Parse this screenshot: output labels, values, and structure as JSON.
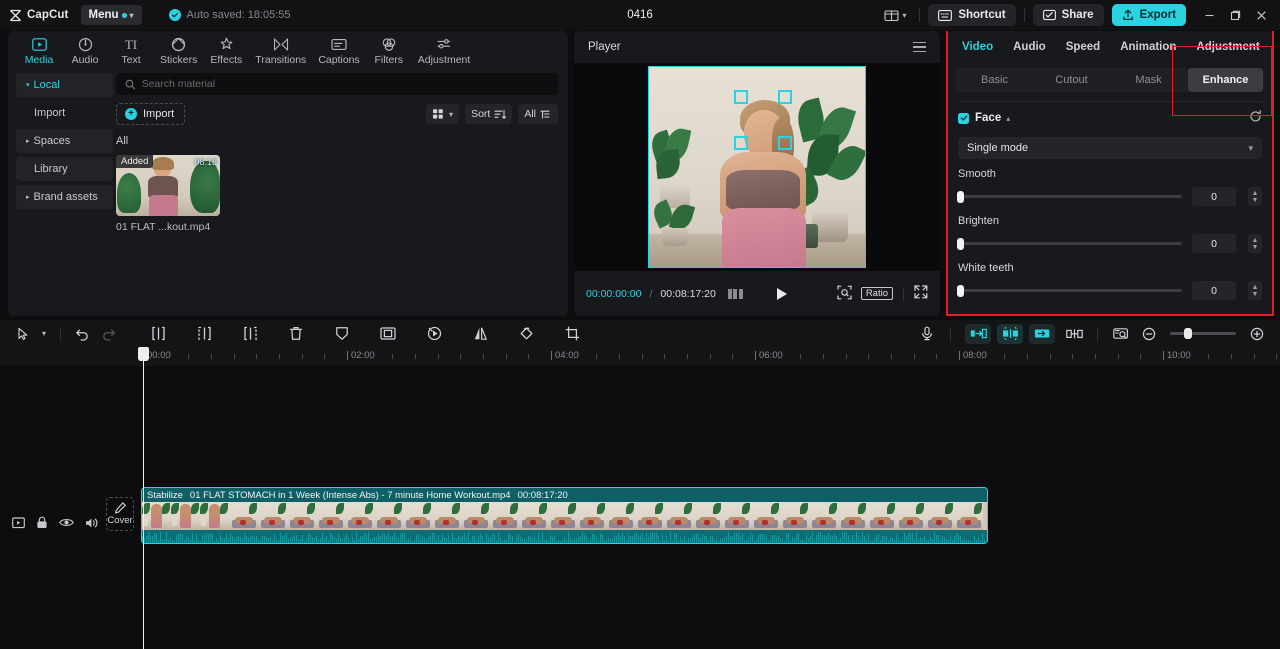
{
  "titlebar": {
    "app_name": "CapCut",
    "menu_label": "Menu",
    "autosave_text": "Auto saved: 18:05:55",
    "project_name": "0416",
    "layout_icon": "panel-layout-icon",
    "shortcut_label": "Shortcut",
    "share_label": "Share",
    "export_label": "Export",
    "minimize": "—",
    "maximize": "❐",
    "close": "✕",
    "accent_color": "#2ad3e0"
  },
  "nav_tabs": [
    {
      "label": "Media",
      "icon": "media-icon",
      "active": true
    },
    {
      "label": "Audio",
      "icon": "audio-icon",
      "active": false
    },
    {
      "label": "Text",
      "icon": "text-icon",
      "active": false
    },
    {
      "label": "Stickers",
      "icon": "stickers-icon",
      "active": false
    },
    {
      "label": "Effects",
      "icon": "effects-icon",
      "active": false
    },
    {
      "label": "Transitions",
      "icon": "transitions-icon",
      "active": false
    },
    {
      "label": "Captions",
      "icon": "captions-icon",
      "active": false
    },
    {
      "label": "Filters",
      "icon": "filters-icon",
      "active": false
    },
    {
      "label": "Adjustment",
      "icon": "adjustment-icon",
      "active": false
    }
  ],
  "sub_nav": [
    {
      "label": "Local",
      "active": true,
      "expandable": true,
      "arrow": "▾"
    },
    {
      "label": "Import",
      "active": false,
      "expandable": false,
      "arrow": ""
    },
    {
      "label": "Spaces",
      "active": false,
      "expandable": true,
      "arrow": "▸"
    },
    {
      "label": "Library",
      "active": false,
      "expandable": false,
      "arrow": ""
    },
    {
      "label": "Brand assets",
      "active": false,
      "expandable": true,
      "arrow": "▸"
    }
  ],
  "media": {
    "search_placeholder": "Search material",
    "search_value": "",
    "import_label": "Import",
    "grid_view_label": "grid-view",
    "sort_label": "Sort",
    "filter_all_label": "All",
    "category_label": "All",
    "items": [
      {
        "name": "01 FLAT ...kout.mp4",
        "badge": "Added",
        "duration": "08:18"
      }
    ]
  },
  "player": {
    "title": "Player",
    "menu_icon": "hamburger-icon",
    "current_time": "00:00:00:00",
    "separator": "/",
    "total_time": "00:08:17:20",
    "quality_icon": "quality-icon",
    "play_icon": "play-icon",
    "zoom_fit_icon": "zoom-fit-icon",
    "ratio_label": "Ratio",
    "fullscreen_icon": "fullscreen-icon",
    "face_detect_overlay": "face-bracket-overlay"
  },
  "right_panel": {
    "tabs": [
      {
        "label": "Video",
        "active": true
      },
      {
        "label": "Audio",
        "active": false
      },
      {
        "label": "Speed",
        "active": false
      },
      {
        "label": "Animation",
        "active": false
      },
      {
        "label": "Adjustment",
        "active": false
      }
    ],
    "segments": [
      {
        "label": "Basic",
        "active": false
      },
      {
        "label": "Cutout",
        "active": false
      },
      {
        "label": "Mask",
        "active": false
      },
      {
        "label": "Enhance",
        "active": true
      }
    ],
    "highlight_color": "#e11d25",
    "face_section": {
      "title": "Face",
      "checked": true,
      "collapse_icon": "chevron-up-icon",
      "reset_icon": "reset-icon",
      "mode_value": "Single mode",
      "sliders": [
        {
          "label": "Smooth",
          "value": "0",
          "percent": 0
        },
        {
          "label": "Brighten",
          "value": "0",
          "percent": 0
        },
        {
          "label": "White teeth",
          "value": "0",
          "percent": 0
        }
      ]
    }
  },
  "timeline_toolbar": {
    "left_tools": [
      {
        "name": "select-tool",
        "dim": false
      },
      {
        "name": "select-dropdown",
        "dim": false
      },
      {
        "name": "undo-button",
        "dim": false
      },
      {
        "name": "redo-button",
        "dim": true
      },
      {
        "name": "split-button",
        "dim": false
      },
      {
        "name": "trim-left-button",
        "dim": false
      },
      {
        "name": "trim-right-button",
        "dim": false
      },
      {
        "name": "delete-button",
        "dim": false
      },
      {
        "name": "freeze-button",
        "dim": false
      },
      {
        "name": "crop-frame-button",
        "dim": false
      },
      {
        "name": "speed-button",
        "dim": false
      },
      {
        "name": "mirror-button",
        "dim": false
      },
      {
        "name": "rotate-button",
        "dim": false
      },
      {
        "name": "crop-button",
        "dim": false
      }
    ],
    "right_tools": [
      {
        "name": "record-voiceover-button"
      },
      {
        "name": "adapt-left-button"
      },
      {
        "name": "auto-fit-button"
      },
      {
        "name": "adapt-right-button"
      },
      {
        "name": "link-button"
      },
      {
        "name": "preview-thumbnail-button"
      },
      {
        "name": "zoom-out-button"
      },
      {
        "name": "zoom-in-button"
      }
    ]
  },
  "timeline": {
    "ruler_labels": [
      "00:00",
      "02:00",
      "04:00",
      "06:00",
      "08:00",
      "10:00"
    ],
    "playhead_position": "00:00",
    "track_controls": [
      {
        "name": "track-thumbnail-toggle"
      },
      {
        "name": "track-lock"
      },
      {
        "name": "track-visibility"
      },
      {
        "name": "track-mute"
      }
    ],
    "cover_label": "Cover",
    "clip": {
      "stabilize_label": "Stabilize",
      "name": "01 FLAT STOMACH in 1 Week (Intense Abs) - 7 minute Home Workout.mp4",
      "duration": "00:08:17:20",
      "selected": true,
      "accent_color": "#2ad3e0"
    }
  }
}
